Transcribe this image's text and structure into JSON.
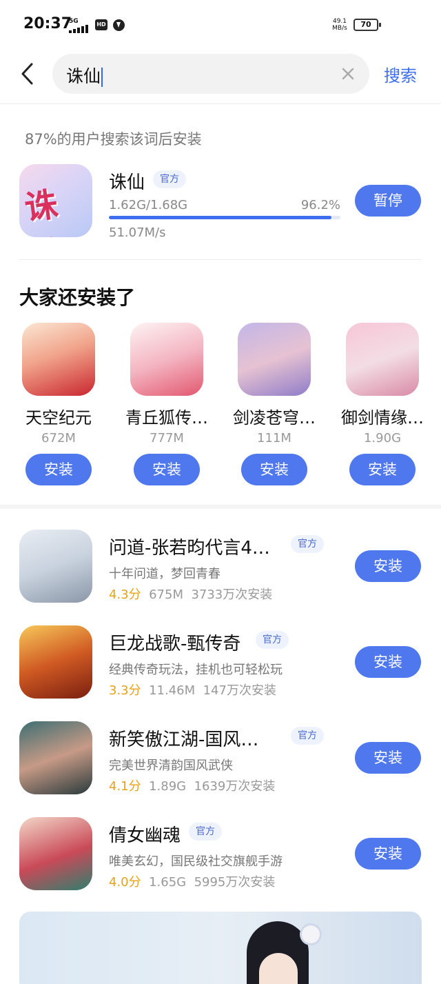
{
  "status_bar": {
    "time": "20:37",
    "network_type": "5G",
    "hd_label": "HD",
    "net_speed_value": "49.1",
    "net_speed_unit": "MB/s",
    "battery": "70"
  },
  "search": {
    "back_icon": "back-arrow-icon",
    "query": "诛仙",
    "clear_icon": "clear-icon",
    "button_label": "搜索"
  },
  "top_result": {
    "hint": "87%的用户搜索该词后安装",
    "icon": "zhuxian-app-icon",
    "icon_text": "诛仙",
    "name": "诛仙",
    "badge": "官方",
    "downloaded": "1.62G/1.68G",
    "percent": "96.2%",
    "progress": 0.962,
    "speed": "51.07M/s",
    "button_label": "暂停"
  },
  "also_installed": {
    "title": "大家还安装了",
    "items": [
      {
        "name": "天空纪元",
        "size": "672M",
        "button_label": "安装",
        "icon": "app-icon"
      },
      {
        "name": "青丘狐传…",
        "size": "777M",
        "button_label": "安装",
        "icon": "app-icon"
      },
      {
        "name": "剑凌苍穹…",
        "size": "111M",
        "button_label": "安装",
        "icon": "app-icon"
      },
      {
        "name": "御剑情缘…",
        "size": "1.90G",
        "button_label": "安装",
        "icon": "app-icon"
      }
    ]
  },
  "app_list": [
    {
      "name": "问道-张若昀代言4…",
      "badge": "官方",
      "desc": "十年问道，梦回青春",
      "rating": "4.3分",
      "size": "675M",
      "installs": "3733万次安装",
      "button_label": "安装"
    },
    {
      "name": "巨龙战歌-甄传奇",
      "badge": "官方",
      "desc": "经典传奇玩法，挂机也可轻松玩",
      "rating": "3.3分",
      "size": "11.46M",
      "installs": "147万次安装",
      "button_label": "安装"
    },
    {
      "name": "新笑傲江湖-国风…",
      "badge": "官方",
      "desc": "完美世界清韵国风武侠",
      "rating": "4.1分",
      "size": "1.89G",
      "installs": "1639万次安装",
      "button_label": "安装"
    },
    {
      "name": "倩女幽魂",
      "badge": "官方",
      "desc": "唯美玄幻，国民级社交旗舰手游",
      "rating": "4.0分",
      "size": "1.65G",
      "installs": "5995万次安装",
      "button_label": "安装"
    }
  ],
  "colors": {
    "accent": "#4f78ef",
    "rating": "#e8a21a",
    "badge_bg": "#eef2fc"
  }
}
